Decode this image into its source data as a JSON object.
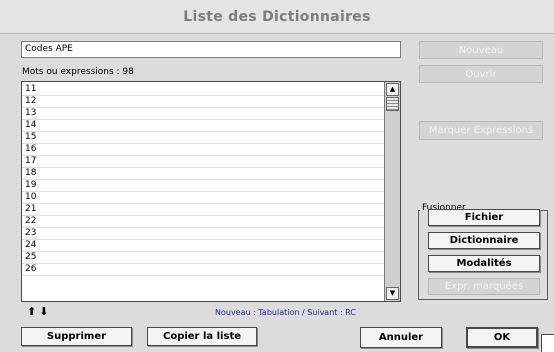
{
  "window": {
    "title": "Liste des Dictionnaires"
  },
  "name_field": {
    "value": "Codes APE"
  },
  "count_label": "Mots ou expressions : 98",
  "list": {
    "items": [
      "11",
      "12",
      "13",
      "14",
      "15",
      "16",
      "17",
      "18",
      "19",
      "10",
      "21",
      "22",
      "23",
      "24",
      "25",
      "26"
    ]
  },
  "scroll_arrows": {
    "up": "▲",
    "down": "▼"
  },
  "nav_arrows": "⬆⬇",
  "hint": "Nouveau : Tabulation / Suivant : RC",
  "buttons": {
    "nouveau": "Nouveau",
    "ouvrir": "Ouvrir",
    "marquer": "Marquer Expressions",
    "supprimer": "Supprimer",
    "copier": "Copier la liste",
    "annuler": "Annuler",
    "ok": "OK"
  },
  "fusionner": {
    "label": "Fusionner",
    "fichier": "Fichier",
    "dictionnaire": "Dictionnaire",
    "modalites": "Modalités",
    "expr_marquees": "Expr. marquées"
  }
}
